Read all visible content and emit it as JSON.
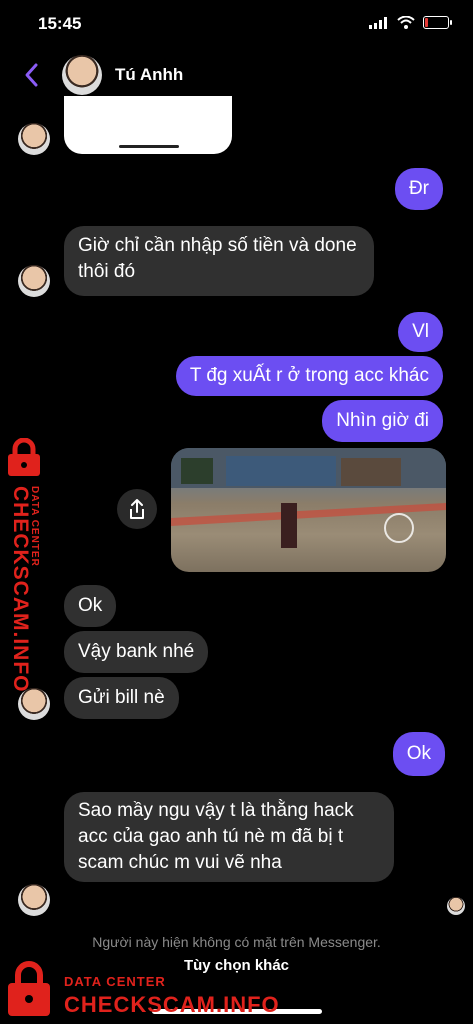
{
  "status": {
    "time": "15:45"
  },
  "header": {
    "contact_name": "Tú Anhh"
  },
  "messages": [
    {
      "from": "me",
      "text": "Đr"
    },
    {
      "from": "them",
      "text": "Giờ chỉ cần nhập số tiền và done thôi đó"
    },
    {
      "from": "me",
      "text": "Vl"
    },
    {
      "from": "me",
      "text": "T đg xuẤt r ở trong acc khác"
    },
    {
      "from": "me",
      "text": "Nhìn giờ đi"
    },
    {
      "from": "them",
      "text": "Ok"
    },
    {
      "from": "them",
      "text": "Vậy bank nhé"
    },
    {
      "from": "them",
      "text": "Gửi bill nè"
    },
    {
      "from": "me",
      "text": "Ok"
    },
    {
      "from": "them",
      "text": "Sao mầy ngu vậy t là thằng hack acc của gao anh tú nè m đã bị t scam chúc m vui vẽ nha"
    }
  ],
  "footer": {
    "note": "Người này hiện không có mặt trên Messenger.",
    "options": "Tùy chọn khác"
  },
  "watermark": {
    "small": "DATA CENTER",
    "big": "CHECKSCAM.INFO"
  },
  "colors": {
    "outgoing_bubble": "#6c4ef2",
    "incoming_bubble": "#303030",
    "watermark": "#e0221c"
  }
}
